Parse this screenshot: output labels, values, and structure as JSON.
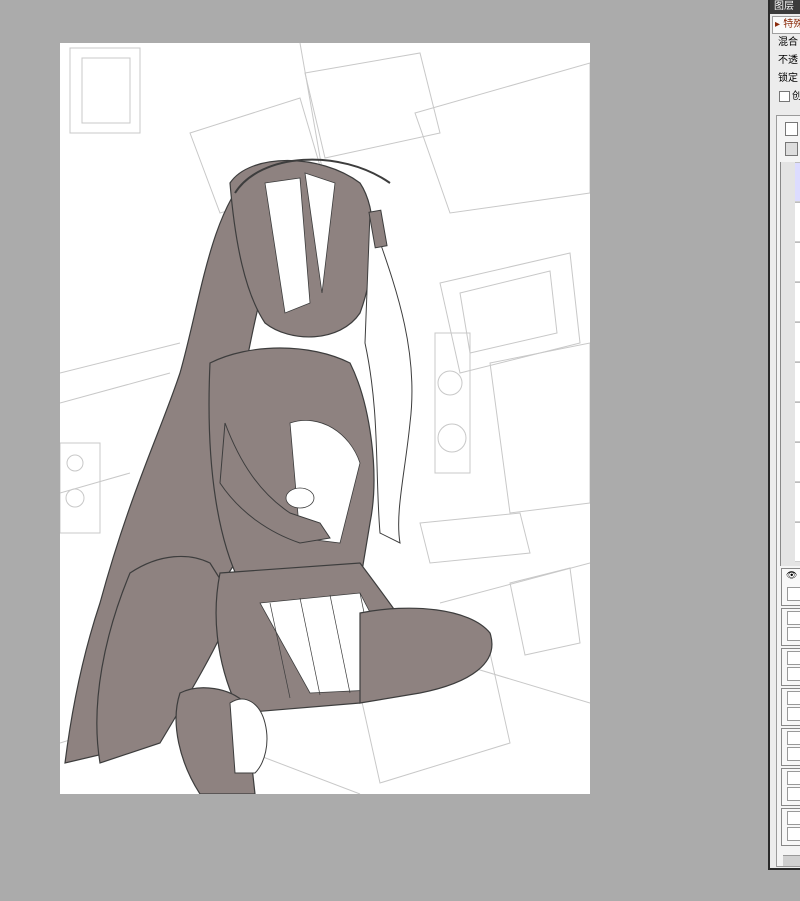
{
  "canvas": {
    "background": "#ababab",
    "artwork_description_colors": {
      "shade": "#8e8280",
      "line": "#555555"
    }
  },
  "layer_panel": {
    "title": "图层",
    "blend_mode_value": "特殊",
    "blend_label": "混合",
    "opacity_label": "不透",
    "lock_label": "锁定",
    "checkbox_label": "创",
    "layers_count_visible": 10
  }
}
